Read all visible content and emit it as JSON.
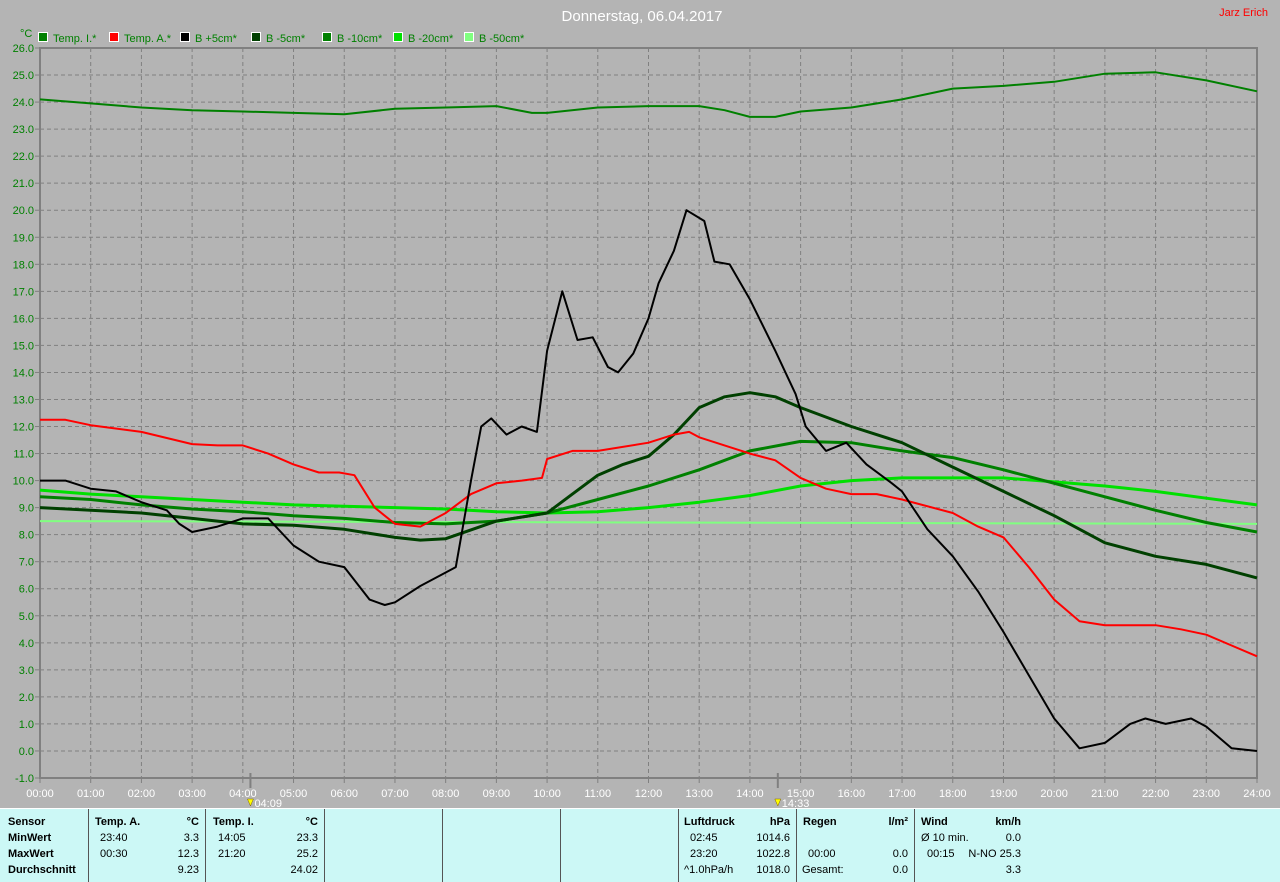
{
  "header": {
    "title": "Donnerstag, 06.04.2017",
    "user": "Jarz Erich"
  },
  "colors": {
    "background": "#b4b4b4",
    "grid": "#808080",
    "panel": "#ccf8f6"
  },
  "chart_data": {
    "type": "line",
    "title": "Donnerstag, 06.04.2017",
    "ylabel": "°C",
    "xlabel": "",
    "xlim": [
      0,
      24
    ],
    "ylim": [
      -1,
      26
    ],
    "grid": true,
    "legend_position": "top",
    "x_ticks": [
      "00:00",
      "01:00",
      "02:00",
      "03:00",
      "04:00",
      "05:00",
      "06:00",
      "07:00",
      "08:00",
      "09:00",
      "10:00",
      "11:00",
      "12:00",
      "13:00",
      "14:00",
      "15:00",
      "16:00",
      "17:00",
      "18:00",
      "19:00",
      "20:00",
      "21:00",
      "22:00",
      "23:00",
      "24:00"
    ],
    "y_ticks": [
      "26.0",
      "25.0",
      "24.0",
      "23.0",
      "22.0",
      "21.0",
      "20.0",
      "19.0",
      "18.0",
      "17.0",
      "16.0",
      "15.0",
      "14.0",
      "13.0",
      "12.0",
      "11.0",
      "10.0",
      "9.0",
      "8.0",
      "7.0",
      "6.0",
      "5.0",
      "4.0",
      "3.0",
      "2.0",
      "1.0",
      "0.0",
      "-1.0"
    ],
    "markers": [
      {
        "label": "04:09",
        "hour": 4.15,
        "icon": "sunrise-icon"
      },
      {
        "label": "14:33",
        "hour": 14.55,
        "icon": "sun-moon-icon"
      }
    ],
    "series": [
      {
        "name": "Temp. I.*",
        "color": "#008000",
        "width": 2,
        "points": [
          [
            0,
            24.1
          ],
          [
            1,
            23.95
          ],
          [
            2,
            23.8
          ],
          [
            3,
            23.7
          ],
          [
            4,
            23.65
          ],
          [
            5,
            23.6
          ],
          [
            6,
            23.55
          ],
          [
            7,
            23.75
          ],
          [
            8,
            23.8
          ],
          [
            9,
            23.85
          ],
          [
            9.7,
            23.6
          ],
          [
            10,
            23.6
          ],
          [
            11,
            23.8
          ],
          [
            12,
            23.85
          ],
          [
            13,
            23.85
          ],
          [
            13.5,
            23.7
          ],
          [
            14,
            23.45
          ],
          [
            14.5,
            23.45
          ],
          [
            15,
            23.65
          ],
          [
            16,
            23.8
          ],
          [
            17,
            24.1
          ],
          [
            18,
            24.5
          ],
          [
            19,
            24.6
          ],
          [
            20,
            24.75
          ],
          [
            21,
            25.05
          ],
          [
            22,
            25.1
          ],
          [
            23,
            24.8
          ],
          [
            24,
            24.4
          ]
        ]
      },
      {
        "name": "Temp. A.*",
        "color": "#ff0000",
        "width": 2,
        "points": [
          [
            0,
            12.25
          ],
          [
            0.5,
            12.25
          ],
          [
            1,
            12.05
          ],
          [
            2,
            11.8
          ],
          [
            3,
            11.35
          ],
          [
            3.5,
            11.3
          ],
          [
            4,
            11.3
          ],
          [
            4.5,
            11.0
          ],
          [
            5,
            10.6
          ],
          [
            5.5,
            10.3
          ],
          [
            5.9,
            10.3
          ],
          [
            6.2,
            10.2
          ],
          [
            6.6,
            9.0
          ],
          [
            7,
            8.4
          ],
          [
            7.5,
            8.3
          ],
          [
            8,
            8.8
          ],
          [
            8.5,
            9.5
          ],
          [
            9,
            9.9
          ],
          [
            9.5,
            10.0
          ],
          [
            9.9,
            10.1
          ],
          [
            10,
            10.8
          ],
          [
            10.5,
            11.1
          ],
          [
            11,
            11.1
          ],
          [
            12,
            11.4
          ],
          [
            12.5,
            11.7
          ],
          [
            12.8,
            11.8
          ],
          [
            13,
            11.6
          ],
          [
            14,
            11.0
          ],
          [
            14.5,
            10.75
          ],
          [
            15,
            10.1
          ],
          [
            15.5,
            9.7
          ],
          [
            16,
            9.5
          ],
          [
            16.5,
            9.5
          ],
          [
            17,
            9.3
          ],
          [
            18,
            8.8
          ],
          [
            18.5,
            8.3
          ],
          [
            19,
            7.9
          ],
          [
            19.5,
            6.8
          ],
          [
            20,
            5.6
          ],
          [
            20.5,
            4.8
          ],
          [
            21,
            4.65
          ],
          [
            22,
            4.65
          ],
          [
            22.5,
            4.5
          ],
          [
            23,
            4.3
          ],
          [
            23.5,
            3.9
          ],
          [
            24,
            3.5
          ]
        ]
      },
      {
        "name": "B +5cm*",
        "color": "#000000",
        "width": 2,
        "points": [
          [
            0,
            10.0
          ],
          [
            0.5,
            10.0
          ],
          [
            1,
            9.7
          ],
          [
            1.5,
            9.6
          ],
          [
            2,
            9.2
          ],
          [
            2.5,
            8.9
          ],
          [
            2.75,
            8.4
          ],
          [
            3,
            8.1
          ],
          [
            3.5,
            8.3
          ],
          [
            4,
            8.6
          ],
          [
            4.5,
            8.6
          ],
          [
            5,
            7.6
          ],
          [
            5.5,
            7.0
          ],
          [
            6,
            6.8
          ],
          [
            6.5,
            5.6
          ],
          [
            6.8,
            5.4
          ],
          [
            7,
            5.5
          ],
          [
            7.5,
            6.1
          ],
          [
            8,
            6.6
          ],
          [
            8.2,
            6.8
          ],
          [
            8.5,
            10.0
          ],
          [
            8.7,
            12.0
          ],
          [
            8.9,
            12.3
          ],
          [
            9.2,
            11.7
          ],
          [
            9.5,
            12.0
          ],
          [
            9.8,
            11.8
          ],
          [
            10,
            14.8
          ],
          [
            10.3,
            17.0
          ],
          [
            10.6,
            15.2
          ],
          [
            10.9,
            15.3
          ],
          [
            11.2,
            14.2
          ],
          [
            11.4,
            14.0
          ],
          [
            11.7,
            14.7
          ],
          [
            12,
            16.0
          ],
          [
            12.2,
            17.3
          ],
          [
            12.5,
            18.5
          ],
          [
            12.75,
            20.0
          ],
          [
            13.1,
            19.6
          ],
          [
            13.3,
            18.1
          ],
          [
            13.6,
            18.0
          ],
          [
            14,
            16.7
          ],
          [
            14.5,
            14.8
          ],
          [
            14.9,
            13.2
          ],
          [
            15.1,
            12.0
          ],
          [
            15.5,
            11.1
          ],
          [
            15.9,
            11.4
          ],
          [
            16.3,
            10.6
          ],
          [
            16.8,
            9.9
          ],
          [
            17,
            9.6
          ],
          [
            17.5,
            8.2
          ],
          [
            18,
            7.2
          ],
          [
            18.5,
            5.9
          ],
          [
            19,
            4.4
          ],
          [
            19.5,
            2.8
          ],
          [
            20,
            1.2
          ],
          [
            20.5,
            0.1
          ],
          [
            21,
            0.3
          ],
          [
            21.5,
            1.0
          ],
          [
            21.8,
            1.2
          ],
          [
            22.2,
            1.0
          ],
          [
            22.7,
            1.2
          ],
          [
            23,
            0.9
          ],
          [
            23.5,
            0.1
          ],
          [
            24,
            0.0
          ]
        ]
      },
      {
        "name": "B -5cm*",
        "color": "#004000",
        "width": 3,
        "points": [
          [
            0,
            9.0
          ],
          [
            1,
            8.9
          ],
          [
            2,
            8.8
          ],
          [
            3,
            8.6
          ],
          [
            4,
            8.4
          ],
          [
            5,
            8.35
          ],
          [
            6,
            8.2
          ],
          [
            7,
            7.9
          ],
          [
            7.5,
            7.8
          ],
          [
            8,
            7.85
          ],
          [
            9,
            8.5
          ],
          [
            10,
            8.8
          ],
          [
            10.5,
            9.5
          ],
          [
            11,
            10.2
          ],
          [
            11.5,
            10.6
          ],
          [
            12,
            10.9
          ],
          [
            12.5,
            11.7
          ],
          [
            13,
            12.7
          ],
          [
            13.5,
            13.1
          ],
          [
            14,
            13.25
          ],
          [
            14.5,
            13.1
          ],
          [
            15,
            12.7
          ],
          [
            16,
            12.0
          ],
          [
            17,
            11.4
          ],
          [
            18,
            10.5
          ],
          [
            19,
            9.6
          ],
          [
            20,
            8.7
          ],
          [
            21,
            7.7
          ],
          [
            22,
            7.2
          ],
          [
            23,
            6.9
          ],
          [
            24,
            6.4
          ]
        ]
      },
      {
        "name": "B -10cm*",
        "color": "#008000",
        "width": 3,
        "points": [
          [
            0,
            9.4
          ],
          [
            1,
            9.3
          ],
          [
            2,
            9.1
          ],
          [
            3,
            8.95
          ],
          [
            4,
            8.85
          ],
          [
            5,
            8.7
          ],
          [
            6,
            8.6
          ],
          [
            7,
            8.45
          ],
          [
            8,
            8.4
          ],
          [
            9,
            8.5
          ],
          [
            10,
            8.8
          ],
          [
            11,
            9.3
          ],
          [
            12,
            9.8
          ],
          [
            13,
            10.4
          ],
          [
            14,
            11.1
          ],
          [
            15,
            11.45
          ],
          [
            16,
            11.4
          ],
          [
            17,
            11.1
          ],
          [
            18,
            10.85
          ],
          [
            19,
            10.4
          ],
          [
            20,
            9.9
          ],
          [
            21,
            9.4
          ],
          [
            22,
            8.9
          ],
          [
            23,
            8.45
          ],
          [
            24,
            8.1
          ]
        ]
      },
      {
        "name": "B -20cm*",
        "color": "#00e000",
        "width": 3,
        "points": [
          [
            0,
            9.65
          ],
          [
            1,
            9.5
          ],
          [
            2,
            9.4
          ],
          [
            3,
            9.3
          ],
          [
            4,
            9.2
          ],
          [
            5,
            9.1
          ],
          [
            6,
            9.05
          ],
          [
            7,
            9.0
          ],
          [
            8,
            8.95
          ],
          [
            9,
            8.85
          ],
          [
            10,
            8.8
          ],
          [
            11,
            8.85
          ],
          [
            12,
            9.0
          ],
          [
            13,
            9.2
          ],
          [
            14,
            9.45
          ],
          [
            15,
            9.8
          ],
          [
            16,
            10.0
          ],
          [
            17,
            10.1
          ],
          [
            18,
            10.1
          ],
          [
            19,
            10.1
          ],
          [
            20,
            9.95
          ],
          [
            21,
            9.8
          ],
          [
            22,
            9.6
          ],
          [
            23,
            9.35
          ],
          [
            24,
            9.1
          ]
        ]
      },
      {
        "name": "B -50cm*",
        "color": "#80ff80",
        "width": 2,
        "points": [
          [
            0,
            8.5
          ],
          [
            12,
            8.45
          ],
          [
            24,
            8.4
          ]
        ]
      }
    ]
  },
  "stats": {
    "labels": {
      "sensor": "Sensor",
      "min": "MinWert",
      "max": "MaxWert",
      "avg": "Durchschnitt"
    },
    "temp_a": {
      "title": "Temp. A.",
      "unit": "°C",
      "min_time": "23:40",
      "min": "3.3",
      "max_time": "00:30",
      "max": "12.3",
      "avg": "9.23"
    },
    "temp_i": {
      "title": "Temp. I.",
      "unit": "°C",
      "min_time": "14:05",
      "min": "23.3",
      "max_time": "21:20",
      "max": "25.2",
      "avg": "24.02"
    },
    "pressure": {
      "title": "Luftdruck",
      "unit": "hPa",
      "min_time": "02:45",
      "min": "1014.6",
      "max_time": "23:20",
      "max": "1022.8",
      "trend": "^1.0hPa/h",
      "current": "1018.0"
    },
    "rain": {
      "title": "Regen",
      "unit": "l/m²",
      "time": "00:00",
      "value": "0.0",
      "total_label": "Gesamt:",
      "total": "0.0"
    },
    "wind": {
      "title": "Wind",
      "unit": "km/h",
      "avg_label": "Ø 10 min.",
      "avg": "0.0",
      "max_time": "00:15",
      "max": "N-NO 25.3",
      "current": "3.3"
    }
  }
}
